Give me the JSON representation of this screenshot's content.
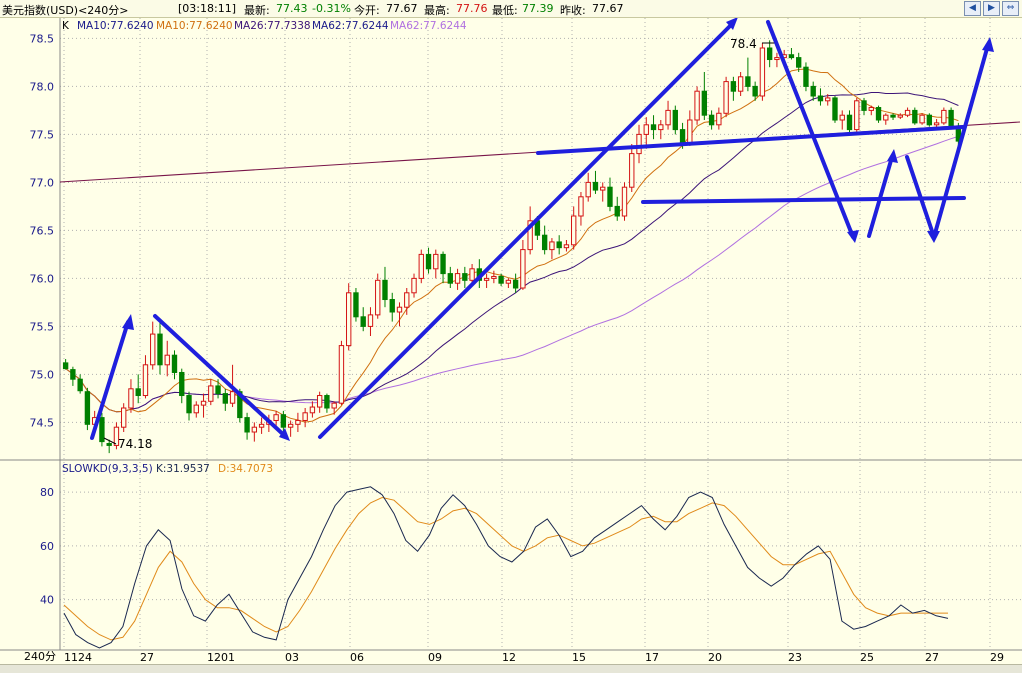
{
  "header": {
    "symbol": "美元指数(USD)<240分>",
    "time": "[03:18:11]",
    "latest_label": "最新:",
    "latest_value": "77.43",
    "change": "-0.31%",
    "open_label": "今开:",
    "open_value": "77.67",
    "high_label": "最高:",
    "high_value": "77.76",
    "low_label": "最低:",
    "low_value": "77.39",
    "prev_close_label": "昨收:",
    "prev_close_value": "77.67"
  },
  "nav": {
    "prev": "◀",
    "next": "▶",
    "expand": "⇔"
  },
  "ma_legend": {
    "k": "K",
    "ma10_a": "MA10:77.6240",
    "ma10_b": "MA10:77.6240",
    "ma26": "MA26:77.7338",
    "ma62_a": "MA62:77.6244",
    "ma62_b": "MA62:77.6244"
  },
  "kd_legend": {
    "name": "SLOWKD(9,3,3,5)",
    "k": "K:31.9537",
    "d": "D:34.7073"
  },
  "period_label": "240分",
  "colors": {
    "background": "#ffffe8",
    "up": "#d41414",
    "down": "#008000",
    "ma10": "#d07010",
    "ma26": "#3c1478",
    "ma62": "#b070e0",
    "long_line": "#781448",
    "drawing": "#1f1fdd",
    "k_line": "#1a2850",
    "d_line": "#e08a1a",
    "axis_label": "#1a1a8a",
    "grid": "#b0b0b0"
  },
  "chart_data": [
    {
      "type": "candlestick",
      "title": "美元指数(USD)<240分>",
      "y_ticks": [
        74.5,
        75.0,
        75.5,
        76.0,
        76.5,
        77.0,
        77.5,
        78.0,
        78.5
      ],
      "ylim": [
        74.15,
        78.65
      ],
      "x_ticks": [
        "1124",
        "27",
        "1201",
        "03",
        "06",
        "09",
        "12",
        "15",
        "17",
        "20",
        "23",
        "25",
        "27",
        "29"
      ],
      "annotations": [
        "74.18",
        "78.4"
      ],
      "series": [
        {
          "name": "MA10",
          "last": 77.624
        },
        {
          "name": "MA26",
          "last": 77.7338
        },
        {
          "name": "MA62",
          "last": 77.6244
        }
      ],
      "candles": [
        [
          75.12,
          75.16,
          75.05,
          75.06
        ],
        [
          75.05,
          75.08,
          74.88,
          74.95
        ],
        [
          74.95,
          75.0,
          74.8,
          74.83
        ],
        [
          74.82,
          74.86,
          74.42,
          74.48
        ],
        [
          74.48,
          74.62,
          74.4,
          74.55
        ],
        [
          74.55,
          74.6,
          74.25,
          74.3
        ],
        [
          74.28,
          74.32,
          74.18,
          74.26
        ],
        [
          74.26,
          74.5,
          74.22,
          74.45
        ],
        [
          74.45,
          74.7,
          74.4,
          74.65
        ],
        [
          74.65,
          74.95,
          74.6,
          74.85
        ],
        [
          74.85,
          75.0,
          74.7,
          74.78
        ],
        [
          74.78,
          75.2,
          74.75,
          75.1
        ],
        [
          75.1,
          75.55,
          75.05,
          75.42
        ],
        [
          75.42,
          75.55,
          75.0,
          75.1
        ],
        [
          75.1,
          75.35,
          74.98,
          75.2
        ],
        [
          75.2,
          75.25,
          74.95,
          75.02
        ],
        [
          75.02,
          75.06,
          74.7,
          74.78
        ],
        [
          74.78,
          74.82,
          74.52,
          74.6
        ],
        [
          74.6,
          74.72,
          74.55,
          74.68
        ],
        [
          74.68,
          74.8,
          74.55,
          74.72
        ],
        [
          74.72,
          74.95,
          74.68,
          74.88
        ],
        [
          74.88,
          74.95,
          74.75,
          74.8
        ],
        [
          74.8,
          74.85,
          74.62,
          74.7
        ],
        [
          74.7,
          75.1,
          74.66,
          74.82
        ],
        [
          74.82,
          74.85,
          74.5,
          74.55
        ],
        [
          74.55,
          74.6,
          74.32,
          74.4
        ],
        [
          74.4,
          74.5,
          74.3,
          74.45
        ],
        [
          74.45,
          74.55,
          74.38,
          74.48
        ],
        [
          74.48,
          74.58,
          74.4,
          74.52
        ],
        [
          74.52,
          74.62,
          74.45,
          74.58
        ],
        [
          74.58,
          74.62,
          74.38,
          74.45
        ],
        [
          74.45,
          74.52,
          74.35,
          74.48
        ],
        [
          74.48,
          74.6,
          74.4,
          74.52
        ],
        [
          74.52,
          74.65,
          74.45,
          74.6
        ],
        [
          74.6,
          74.72,
          74.55,
          74.66
        ],
        [
          74.66,
          74.82,
          74.6,
          74.78
        ],
        [
          74.78,
          74.8,
          74.6,
          74.65
        ],
        [
          74.65,
          74.72,
          74.58,
          74.7
        ],
        [
          74.7,
          75.35,
          74.68,
          75.3
        ],
        [
          75.3,
          75.95,
          75.25,
          75.85
        ],
        [
          75.85,
          75.9,
          75.55,
          75.6
        ],
        [
          75.6,
          75.7,
          75.45,
          75.5
        ],
        [
          75.5,
          75.7,
          75.4,
          75.62
        ],
        [
          75.62,
          76.05,
          75.58,
          75.98
        ],
        [
          75.98,
          76.12,
          75.7,
          75.78
        ],
        [
          75.78,
          75.85,
          75.55,
          75.65
        ],
        [
          75.65,
          75.75,
          75.5,
          75.7
        ],
        [
          75.7,
          75.9,
          75.62,
          75.85
        ],
        [
          75.85,
          76.05,
          75.8,
          76.0
        ],
        [
          76.0,
          76.3,
          75.95,
          76.25
        ],
        [
          76.25,
          76.32,
          76.05,
          76.1
        ],
        [
          76.1,
          76.3,
          76.0,
          76.25
        ],
        [
          76.25,
          76.28,
          75.95,
          76.05
        ],
        [
          76.05,
          76.12,
          75.9,
          75.95
        ],
        [
          75.95,
          76.1,
          75.88,
          76.05
        ],
        [
          76.05,
          76.12,
          75.9,
          75.98
        ],
        [
          75.98,
          76.15,
          75.95,
          76.1
        ],
        [
          76.1,
          76.2,
          75.9,
          75.98
        ],
        [
          75.98,
          76.05,
          75.9,
          76.0
        ],
        [
          76.0,
          76.08,
          75.95,
          76.02
        ],
        [
          76.02,
          76.05,
          75.92,
          75.95
        ],
        [
          75.95,
          76.0,
          75.9,
          75.98
        ],
        [
          75.98,
          76.05,
          75.85,
          75.9
        ],
        [
          75.9,
          76.4,
          75.88,
          76.3
        ],
        [
          76.3,
          76.75,
          76.25,
          76.6
        ],
        [
          76.6,
          76.65,
          76.4,
          76.45
        ],
        [
          76.45,
          76.55,
          76.25,
          76.3
        ],
        [
          76.3,
          76.42,
          76.2,
          76.38
        ],
        [
          76.38,
          76.45,
          76.25,
          76.32
        ],
        [
          76.32,
          76.4,
          76.28,
          76.35
        ],
        [
          76.35,
          76.75,
          76.3,
          76.65
        ],
        [
          76.65,
          76.9,
          76.55,
          76.85
        ],
        [
          76.85,
          77.1,
          76.8,
          77.0
        ],
        [
          77.0,
          77.12,
          76.88,
          76.92
        ],
        [
          76.92,
          77.0,
          76.8,
          76.95
        ],
        [
          76.95,
          77.05,
          76.7,
          76.75
        ],
        [
          76.75,
          76.85,
          76.6,
          76.65
        ],
        [
          76.65,
          77.0,
          76.6,
          76.95
        ],
        [
          76.95,
          77.4,
          76.9,
          77.3
        ],
        [
          77.3,
          77.6,
          77.2,
          77.5
        ],
        [
          77.5,
          77.68,
          77.35,
          77.6
        ],
        [
          77.6,
          77.7,
          77.45,
          77.55
        ],
        [
          77.55,
          77.65,
          77.45,
          77.6
        ],
        [
          77.6,
          77.85,
          77.55,
          77.75
        ],
        [
          77.75,
          77.8,
          77.5,
          77.55
        ],
        [
          77.55,
          77.62,
          77.35,
          77.4
        ],
        [
          77.4,
          77.75,
          77.38,
          77.65
        ],
        [
          77.65,
          78.0,
          77.6,
          77.95
        ],
        [
          77.95,
          78.15,
          77.65,
          77.7
        ],
        [
          77.7,
          77.75,
          77.55,
          77.6
        ],
        [
          77.6,
          77.78,
          77.55,
          77.72
        ],
        [
          77.72,
          78.1,
          77.68,
          78.05
        ],
        [
          78.05,
          78.1,
          77.85,
          77.95
        ],
        [
          77.95,
          78.15,
          77.9,
          78.1
        ],
        [
          78.1,
          78.3,
          77.95,
          78.0
        ],
        [
          78.0,
          78.05,
          77.85,
          77.9
        ],
        [
          77.9,
          78.45,
          77.85,
          78.4
        ],
        [
          78.4,
          78.48,
          78.2,
          78.28
        ],
        [
          78.28,
          78.35,
          78.2,
          78.3
        ],
        [
          78.3,
          78.38,
          78.25,
          78.33
        ],
        [
          78.33,
          78.4,
          78.28,
          78.3
        ],
        [
          78.3,
          78.35,
          78.15,
          78.2
        ],
        [
          78.2,
          78.25,
          77.95,
          78.0
        ],
        [
          78.0,
          78.05,
          77.85,
          77.9
        ],
        [
          77.9,
          77.98,
          77.8,
          77.85
        ],
        [
          77.85,
          77.92,
          77.8,
          77.88
        ],
        [
          77.88,
          77.9,
          77.62,
          77.65
        ],
        [
          77.65,
          77.75,
          77.55,
          77.7
        ],
        [
          77.7,
          77.75,
          77.5,
          77.55
        ],
        [
          77.55,
          77.88,
          77.52,
          77.85
        ],
        [
          77.85,
          77.88,
          77.7,
          77.75
        ],
        [
          77.75,
          77.8,
          77.7,
          77.78
        ],
        [
          77.78,
          77.8,
          77.62,
          77.65
        ],
        [
          77.65,
          77.72,
          77.6,
          77.7
        ],
        [
          77.7,
          77.72,
          77.65,
          77.68
        ],
        [
          77.68,
          77.72,
          77.66,
          77.7
        ],
        [
          77.7,
          77.78,
          77.68,
          77.75
        ],
        [
          77.75,
          77.78,
          77.6,
          77.62
        ],
        [
          77.62,
          77.72,
          77.6,
          77.7
        ],
        [
          77.7,
          77.72,
          77.58,
          77.6
        ],
        [
          77.6,
          77.66,
          77.55,
          77.62
        ],
        [
          77.62,
          77.78,
          77.6,
          77.75
        ],
        [
          77.75,
          77.78,
          77.55,
          77.58
        ],
        [
          77.58,
          77.62,
          77.38,
          77.43
        ]
      ]
    },
    {
      "type": "line",
      "title": "SLOWKD(9,3,3,5)",
      "y_ticks": [
        40,
        60,
        80
      ],
      "ylim": [
        22,
        86
      ],
      "series": [
        {
          "name": "K",
          "last": 31.9537,
          "values": [
            35,
            27,
            24,
            22,
            24,
            30,
            46,
            60,
            66,
            62,
            44,
            34,
            32,
            38,
            42,
            35,
            28,
            26,
            25,
            40,
            48,
            56,
            66,
            75,
            80,
            81,
            82,
            79,
            72,
            62,
            58,
            64,
            74,
            79,
            75,
            68,
            60,
            56,
            54,
            58,
            67,
            70,
            64,
            56,
            58,
            63,
            66,
            69,
            72,
            75,
            70,
            66,
            71,
            78,
            80,
            78,
            68,
            60,
            52,
            48,
            45,
            48,
            53,
            57,
            60,
            55,
            32,
            29,
            30,
            32,
            34,
            38,
            35,
            36,
            34,
            33
          ]
        },
        {
          "name": "D",
          "last": 34.7073,
          "values": [
            38,
            34,
            30,
            27,
            25,
            26,
            32,
            42,
            52,
            58,
            54,
            46,
            40,
            37,
            37,
            36,
            33,
            30,
            28,
            30,
            36,
            43,
            51,
            59,
            66,
            72,
            76,
            78,
            77,
            73,
            69,
            68,
            70,
            73,
            74,
            72,
            68,
            64,
            60,
            58,
            60,
            63,
            64,
            62,
            60,
            61,
            63,
            65,
            67,
            70,
            71,
            69,
            69,
            72,
            74,
            76,
            75,
            71,
            66,
            61,
            56,
            53,
            53,
            55,
            57,
            58,
            50,
            42,
            37,
            35,
            34,
            35,
            35,
            35,
            35,
            35
          ]
        }
      ]
    }
  ]
}
